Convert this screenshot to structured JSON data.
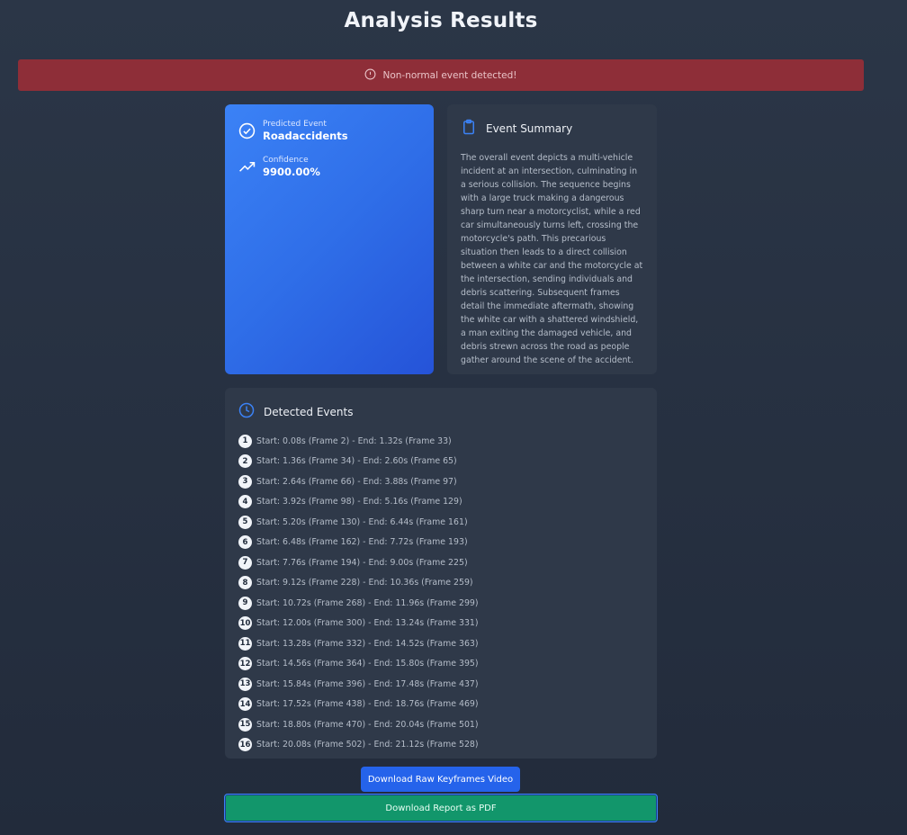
{
  "page_title": "Analysis Results",
  "alert": {
    "text": "Non-normal event detected!",
    "icon": "info-circle-icon",
    "color": "#8e2e38"
  },
  "prediction": {
    "event_label": "Predicted Event",
    "event_value": "Roadaccidents",
    "confidence_label": "Confidence",
    "confidence_value": "9900.00%"
  },
  "summary": {
    "title": "Event Summary",
    "text": "The overall event depicts a multi-vehicle incident at an intersection, culminating in a serious collision. The sequence begins with a large truck making a dangerous sharp turn near a motorcyclist, while a red car simultaneously turns left, crossing the motorcycle's path. This precarious situation then leads to a direct collision between a white car and the motorcycle at the intersection, sending individuals and debris scattering. Subsequent frames detail the immediate aftermath, showing the white car with a shattered windshield, a man exiting the damaged vehicle, and debris strewn across the road as people gather around the scene of the accident."
  },
  "events": {
    "title": "Detected Events",
    "items": [
      {
        "num": "1",
        "text": "Start: 0.08s (Frame 2) - End: 1.32s (Frame 33)"
      },
      {
        "num": "2",
        "text": "Start: 1.36s (Frame 34) - End: 2.60s (Frame 65)"
      },
      {
        "num": "3",
        "text": "Start: 2.64s (Frame 66) - End: 3.88s (Frame 97)"
      },
      {
        "num": "4",
        "text": "Start: 3.92s (Frame 98) - End: 5.16s (Frame 129)"
      },
      {
        "num": "5",
        "text": "Start: 5.20s (Frame 130) - End: 6.44s (Frame 161)"
      },
      {
        "num": "6",
        "text": "Start: 6.48s (Frame 162) - End: 7.72s (Frame 193)"
      },
      {
        "num": "7",
        "text": "Start: 7.76s (Frame 194) - End: 9.00s (Frame 225)"
      },
      {
        "num": "8",
        "text": "Start: 9.12s (Frame 228) - End: 10.36s (Frame 259)"
      },
      {
        "num": "9",
        "text": "Start: 10.72s (Frame 268) - End: 11.96s (Frame 299)"
      },
      {
        "num": "10",
        "text": "Start: 12.00s (Frame 300) - End: 13.24s (Frame 331)"
      },
      {
        "num": "11",
        "text": "Start: 13.28s (Frame 332) - End: 14.52s (Frame 363)"
      },
      {
        "num": "12",
        "text": "Start: 14.56s (Frame 364) - End: 15.80s (Frame 395)"
      },
      {
        "num": "13",
        "text": "Start: 15.84s (Frame 396) - End: 17.48s (Frame 437)"
      },
      {
        "num": "14",
        "text": "Start: 17.52s (Frame 438) - End: 18.76s (Frame 469)"
      },
      {
        "num": "15",
        "text": "Start: 18.80s (Frame 470) - End: 20.04s (Frame 501)"
      },
      {
        "num": "16",
        "text": "Start: 20.08s (Frame 502) - End: 21.12s (Frame 528)"
      }
    ]
  },
  "buttons": {
    "video_label": "Download Raw Keyframes Video",
    "pdf_label": "Download Report as PDF"
  },
  "colors": {
    "primary_blue": "#2563eb",
    "card_bg": "#2f3949",
    "success_green": "#12966b",
    "danger_red": "#8e2e38"
  }
}
